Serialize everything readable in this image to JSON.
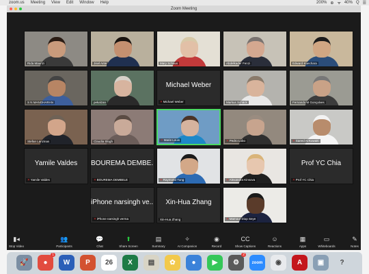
{
  "menubar": {
    "items": [
      "zoom.us",
      "Meeting",
      "View",
      "Edit",
      "Window",
      "Help"
    ],
    "status": [
      "200%",
      "⊕",
      "ᯤ",
      "40%",
      "Q",
      "☰"
    ]
  },
  "window": {
    "title": "Zoom Meeting"
  },
  "participants": [
    {
      "name": "Rida Maurizi",
      "mic_off": false,
      "video": true,
      "skin": "#c99b7c",
      "hair": "#2a1c14",
      "shirt": "#3a3a3a",
      "bg": "#8d8a84"
    },
    {
      "name": "Jisel Ante",
      "mic_off": false,
      "video": true,
      "skin": "#c49070",
      "hair": "#1a1410",
      "shirt": "#203050",
      "bg": "#b9b09d"
    },
    {
      "name": "Mary Schaus",
      "mic_off": false,
      "video": true,
      "skin": "#e2c0a7",
      "hair": "#d8c9a8",
      "shirt": "#c23a3a",
      "bg": "#e4e0d5"
    },
    {
      "name": "Abdelkader Fenzi",
      "mic_off": false,
      "video": true,
      "skin": "#d4a890",
      "hair": "#7a7370",
      "shirt": "#2a2e3a",
      "bg": "#c7c2b7"
    },
    {
      "name": "Edward Kuechara",
      "mic_off": false,
      "video": true,
      "skin": "#d0a683",
      "hair": "#1c1c1c",
      "shirt": "#2b4d7a",
      "bg": "#c9b89c"
    },
    {
      "name": "S N MANOHARAN",
      "mic_off": false,
      "video": true,
      "skin": "#b78564",
      "hair": "#444",
      "shirt": "#3d5f9c",
      "bg": "#6a665f"
    },
    {
      "name": "pekalzan",
      "mic_off": false,
      "video": true,
      "skin": "#d7b49f",
      "hair": "#d6d0c8",
      "shirt": "#2a2a2a",
      "bg": "#5b7261"
    },
    {
      "name": "Michael Weber",
      "display_name": "Michael Weber",
      "mic_off": true,
      "video": false
    },
    {
      "name": "Markus Schäck",
      "mic_off": false,
      "video": true,
      "skin": "#d9b49c",
      "hair": "#8a7a6a",
      "shirt": "#e8e8e8",
      "bg": "#b4b3ae"
    },
    {
      "name": "Fernando M Gonçalves",
      "mic_off": false,
      "video": true,
      "skin": "#c9a287",
      "hair": "#777",
      "shirt": "#3c3c3c",
      "bg": "#9b9b93"
    },
    {
      "name": "Stefan Lanzinas",
      "mic_off": false,
      "video": true,
      "skin": "#d2a58a",
      "hair": "#6f6256",
      "shirt": "#20232a",
      "bg": "#7a6250"
    },
    {
      "name": "Claudia Slogh",
      "mic_off": false,
      "video": true,
      "skin": "#c9aa99",
      "hair": "#5b4c44",
      "shirt": "#6b5d59",
      "bg": "#8c7b76"
    },
    {
      "name": "Marie Louis",
      "mic_off": true,
      "video": true,
      "skin": "#d6b39e",
      "hair": "#4a3328",
      "shirt": "#1e88c8",
      "bg": "#6f9cc5",
      "speaking": true
    },
    {
      "name": "Pedro Lobo",
      "mic_off": true,
      "video": true,
      "skin": "#c7a48e",
      "hair": "#9a8c80",
      "shirt": "#2f2f2f",
      "bg": "#93897e"
    },
    {
      "name": "Saeed Al Kuwaiti",
      "mic_off": true,
      "video": true,
      "skin": "#b88c6c",
      "hair": "#f3f3f3",
      "shirt": "#f5f5f5",
      "bg": "#c9c9c6"
    },
    {
      "name": "Yamile Valdes",
      "display_name": "Yamile Valdes",
      "mic_off": true,
      "video": false
    },
    {
      "name": "BOUREMA DEMBELE",
      "display_name": "BOUREMA DEMBE...",
      "mic_off": true,
      "video": false
    },
    {
      "name": "Raymond Tung",
      "mic_off": true,
      "video": true,
      "skin": "#d3a888",
      "hair": "#1a1a1a",
      "shirt": "#2d6bb3",
      "bg": "#e1e3e5"
    },
    {
      "name": "Alexandra Kinsova",
      "mic_off": true,
      "video": true,
      "skin": "#e7c7af",
      "hair": "#d9b479",
      "shirt": "#1f1f1f",
      "bg": "#e9e6e2"
    },
    {
      "name": "Prof YC Chia",
      "display_name": "Prof YC Chia",
      "mic_off": true,
      "video": false
    },
    {
      "name": "iPhone narsingh verma",
      "display_name": "iPhone narsingh ve...",
      "mic_off": true,
      "video": false
    },
    {
      "name": "Xin-Hua Zhang",
      "display_name": "Xin-Hua Zhang",
      "mic_off": false,
      "video": false
    },
    {
      "name": "Mamour Diop Seye",
      "mic_off": true,
      "video": true,
      "skin": "#5a3b2a",
      "hair": "#1a1a1a",
      "shirt": "#1c2340",
      "bg": "#ecebe7"
    }
  ],
  "toolbar": [
    {
      "name": "stop-video",
      "icon": "▮◂",
      "label": "Stop Video"
    },
    {
      "name": "participants",
      "icon": "👥",
      "label": "Participants"
    },
    {
      "name": "chat",
      "icon": "💬",
      "label": "Chat"
    },
    {
      "name": "share-screen",
      "icon": "⬆",
      "label": "Share Screen",
      "green": true
    },
    {
      "name": "summary",
      "icon": "▤",
      "label": "Summary"
    },
    {
      "name": "ai-companion",
      "icon": "✧",
      "label": "AI Companion"
    },
    {
      "name": "record",
      "icon": "◉",
      "label": "Record"
    },
    {
      "name": "show-captions",
      "icon": "CC",
      "label": "Show Captions"
    },
    {
      "name": "reactions",
      "icon": "☺",
      "label": "Reactions"
    },
    {
      "name": "apps",
      "icon": "▦",
      "label": "Apps"
    },
    {
      "name": "whiteboards",
      "icon": "▭",
      "label": "Whiteboards"
    },
    {
      "name": "notes",
      "icon": "✎",
      "label": "Notes"
    }
  ],
  "dock": [
    {
      "name": "launchpad",
      "glyph": "🚀",
      "color": "#7b8ea3"
    },
    {
      "name": "calendar-red",
      "glyph": "●",
      "color": "#e24c3f",
      "badge": "1"
    },
    {
      "name": "word",
      "glyph": "W",
      "color": "#2b5fb8"
    },
    {
      "name": "powerpoint",
      "glyph": "P",
      "color": "#d35230"
    },
    {
      "name": "calendar",
      "glyph": "26",
      "color": "#ffffff"
    },
    {
      "name": "excel",
      "glyph": "X",
      "color": "#1e7b46"
    },
    {
      "name": "preview",
      "glyph": "▤",
      "color": "#d8d4c5"
    },
    {
      "name": "photos",
      "glyph": "✿",
      "color": "#f2c94c"
    },
    {
      "name": "messages-blue",
      "glyph": "●",
      "color": "#3b82d9"
    },
    {
      "name": "facetime",
      "glyph": "▶",
      "color": "#34c759"
    },
    {
      "name": "app-gray",
      "glyph": "⚙",
      "color": "#5a5a5a",
      "badge": "2"
    },
    {
      "name": "zoom",
      "glyph": "zoom",
      "color": "#2d8cff"
    },
    {
      "name": "chrome",
      "glyph": "◉",
      "color": "#e8eaed"
    },
    {
      "name": "acrobat",
      "glyph": "A",
      "color": "#c4161c"
    },
    {
      "name": "image-app",
      "glyph": "▣",
      "color": "#8aa0b5"
    },
    {
      "name": "help",
      "glyph": "?",
      "color": "#cfd6dc"
    }
  ]
}
